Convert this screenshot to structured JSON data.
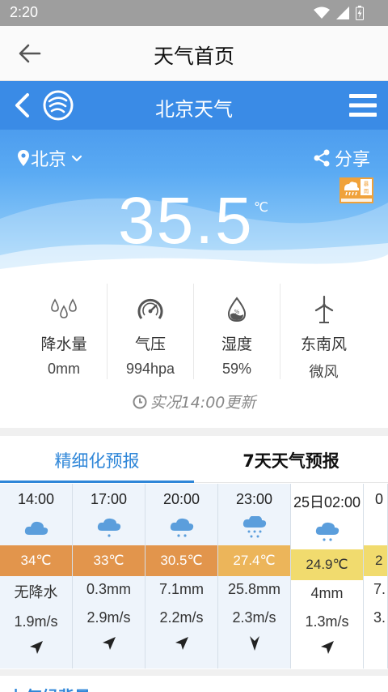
{
  "status_bar": {
    "time": "2:20"
  },
  "app_bar": {
    "title": "天气首页"
  },
  "header": {
    "title": "北京天气"
  },
  "location": {
    "city": "北京",
    "share_label": "分享"
  },
  "warning": {
    "label": "暴雨"
  },
  "current": {
    "temperature": "35.5",
    "unit": "℃"
  },
  "stats": [
    {
      "label": "降水量",
      "value": "0mm",
      "icon": "raindrops-icon"
    },
    {
      "label": "气压",
      "value": "994hpa",
      "icon": "gauge-icon"
    },
    {
      "label": "湿度",
      "value": "59%",
      "icon": "humidity-drop-icon"
    },
    {
      "label": "东南风",
      "value": "微风",
      "icon": "wind-turbine-icon"
    }
  ],
  "updated": "实况14:00更新",
  "tabs": [
    {
      "label": "精细化预报",
      "active": true
    },
    {
      "label": "7天天气预报",
      "active": false
    }
  ],
  "hourly": [
    {
      "time": "14:00",
      "temp": "34℃",
      "temp_color": "#e2954c",
      "precip": "无降水",
      "wind_speed": "1.9m/s"
    },
    {
      "time": "17:00",
      "temp": "33℃",
      "temp_color": "#e2954c",
      "precip": "0.3mm",
      "wind_speed": "2.9m/s"
    },
    {
      "time": "20:00",
      "temp": "30.5℃",
      "temp_color": "#e2954c",
      "precip": "7.1mm",
      "wind_speed": "2.2m/s"
    },
    {
      "time": "23:00",
      "temp": "27.4℃",
      "temp_color": "#ecb55a",
      "precip": "25.8mm",
      "wind_speed": "2.3m/s"
    },
    {
      "time": "25日02:00",
      "temp": "24.9℃",
      "temp_color": "#f1db6e",
      "precip": "4mm",
      "wind_speed": "1.3m/s"
    }
  ],
  "hourly_partial": {
    "time": "0",
    "temp": "2",
    "temp_color": "#f1db6e",
    "precip": "7.",
    "wind_speed": "3."
  },
  "colors": {
    "accent": "#2e86d8",
    "header_blue": "#3a8be6"
  },
  "next_section": "七气候背景"
}
